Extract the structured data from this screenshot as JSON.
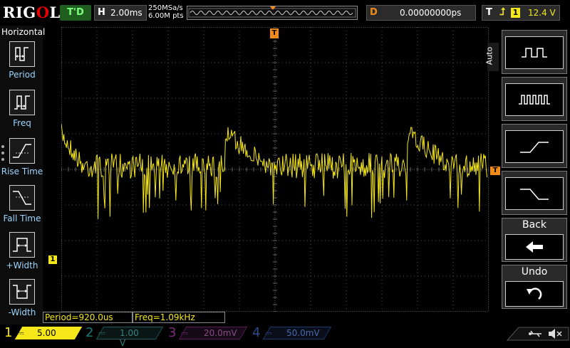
{
  "top_bar": {
    "logo": "RIGOL",
    "run_state": "T'D",
    "horizontal_label": "H",
    "timebase": "2.00ms",
    "sample_rate": "250MSa/s",
    "memory_depth": "6.00M pts",
    "delay_label": "D",
    "delay_value": "0.00000000ps",
    "trigger_label": "T",
    "trigger_source": "1",
    "trigger_level": "12.4 V"
  },
  "left_menu": {
    "title": "Horizontal",
    "items": [
      {
        "label": "Period",
        "icon": "period-icon"
      },
      {
        "label": "Freq",
        "icon": "frequency-icon"
      },
      {
        "label": "Rise Time",
        "icon": "rise-time-icon"
      },
      {
        "label": "Fall Time",
        "icon": "fall-time-icon"
      },
      {
        "label": "+Width",
        "icon": "positive-width-icon"
      },
      {
        "label": "-Width",
        "icon": "negative-width-icon"
      }
    ]
  },
  "right_menu": {
    "tab_label": "Auto",
    "back_label": "Back",
    "undo_label": "Undo"
  },
  "measurements": {
    "period": "Period=920.0us",
    "frequency": "Freq=1.09kHz"
  },
  "channels": [
    {
      "number": "1",
      "scale": "5.00 V",
      "color": "#f5e71a",
      "active": true
    },
    {
      "number": "2",
      "scale": "1.00 V",
      "color": "#19b4b4",
      "active": false
    },
    {
      "number": "3",
      "scale": "20.0mV",
      "color": "#c833c8",
      "active": false
    },
    {
      "number": "4",
      "scale": "50.0mV",
      "color": "#3366ff",
      "active": false
    }
  ],
  "colors": {
    "trace": "#f5e71a",
    "trigger_marker": "#f08a18",
    "menu_label": "#9cd5ff"
  }
}
